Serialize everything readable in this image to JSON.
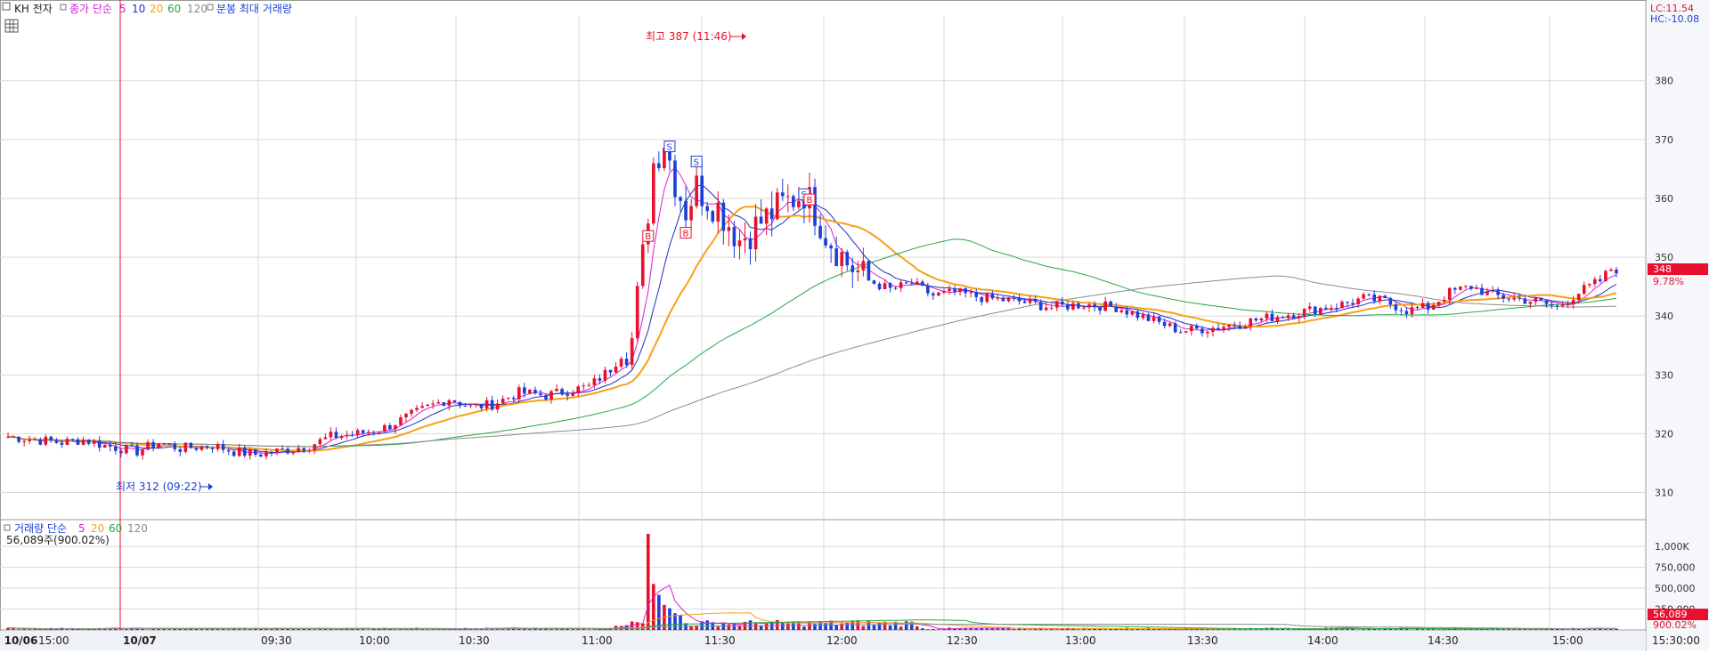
{
  "header": {
    "symbol": "KH 전자",
    "price_legend": {
      "label": "종가 단순",
      "periods": [
        "5",
        "10",
        "20",
        "60",
        "120"
      ]
    },
    "volume_legend_title": "분봉 최대 거래량"
  },
  "volume_panel": {
    "legend_label": "거래량 단순",
    "periods": [
      "5",
      "20",
      "60",
      "120"
    ],
    "info": "56,089주(900.02%)"
  },
  "right_info": {
    "lc": "LC:11.54",
    "hc": "HC:-10.08"
  },
  "colors": {
    "up": "#e8102c",
    "down": "#1b3fd8",
    "ma5": "#d81ed8",
    "ma10": "#1f2fbf",
    "ma20": "#f5a11a",
    "ma60": "#22a846",
    "ma120": "#8c8c8c",
    "grid": "#d9d9d9",
    "axis_text": "#333333"
  },
  "chart_data": {
    "type": "candlestick",
    "price_axis": {
      "ticks": [
        310,
        320,
        330,
        340,
        350,
        360,
        370,
        380
      ],
      "ylim": [
        306,
        391
      ]
    },
    "volume_axis": {
      "ticks": [
        "250,000",
        "500,000",
        "750,000",
        "1,000K"
      ],
      "ylim": [
        0,
        1150000
      ]
    },
    "time_axis": [
      "10/06",
      "15:00",
      "10/07",
      "09:30",
      "10:00",
      "10:30",
      "11:00",
      "11:30",
      "12:00",
      "12:30",
      "13:00",
      "13:30",
      "14:00",
      "14:30",
      "15:00",
      "15:30:00"
    ],
    "last_price": {
      "value": "348",
      "change": "9.78%"
    },
    "last_volume": {
      "value": "56,089",
      "ratio": "900.02%"
    },
    "annotations": {
      "high": {
        "text": "최고 387 (11:46)",
        "value": 387
      },
      "low": {
        "text": "최저 312 (09:22)",
        "value": 312
      }
    },
    "session_path": [
      [
        0,
        319.5
      ],
      [
        5,
        319.0
      ],
      [
        10,
        318.5
      ],
      [
        14,
        319.0
      ],
      [
        18,
        318.0
      ],
      [
        24,
        317.0
      ],
      [
        28,
        318.5
      ],
      [
        32,
        317.5
      ],
      [
        38,
        318.0
      ],
      [
        42,
        317.0
      ],
      [
        46,
        316.5
      ],
      [
        50,
        317.0
      ],
      [
        56,
        318.0
      ],
      [
        60,
        319.5
      ],
      [
        65,
        320.0
      ],
      [
        70,
        321.0
      ],
      [
        78,
        324.5
      ],
      [
        82,
        326.0
      ],
      [
        86,
        324.5
      ],
      [
        90,
        325.0
      ],
      [
        95,
        327.0
      ],
      [
        100,
        326.5
      ],
      [
        105,
        327.5
      ],
      [
        108,
        328.0
      ],
      [
        112,
        331.0
      ],
      [
        116,
        336.0
      ],
      [
        118,
        350.0
      ],
      [
        120,
        366.0
      ],
      [
        122,
        370.0
      ],
      [
        124,
        363.0
      ],
      [
        126,
        358.0
      ],
      [
        128,
        362.0
      ],
      [
        130,
        360.0
      ],
      [
        132,
        358.5
      ],
      [
        136,
        353.0
      ],
      [
        140,
        356.0
      ],
      [
        144,
        359.0
      ],
      [
        148,
        361.0
      ],
      [
        150,
        358.0
      ],
      [
        152,
        354.0
      ],
      [
        156,
        349.0
      ],
      [
        160,
        346.0
      ],
      [
        164,
        344.5
      ],
      [
        168,
        345.5
      ],
      [
        172,
        343.5
      ],
      [
        176,
        344.0
      ],
      [
        182,
        343.0
      ],
      [
        188,
        342.5
      ],
      [
        194,
        341.5
      ],
      [
        200,
        342.0
      ],
      [
        206,
        341.5
      ],
      [
        212,
        339.5
      ],
      [
        218,
        337.5
      ],
      [
        224,
        338.0
      ],
      [
        230,
        339.0
      ],
      [
        236,
        340.0
      ],
      [
        242,
        341.0
      ],
      [
        248,
        342.0
      ],
      [
        252,
        343.0
      ],
      [
        256,
        342.5
      ],
      [
        260,
        341.0
      ],
      [
        264,
        341.5
      ],
      [
        268,
        344.0
      ],
      [
        272,
        345.0
      ],
      [
        276,
        343.5
      ],
      [
        280,
        343.0
      ],
      [
        284,
        342.5
      ],
      [
        288,
        341.5
      ],
      [
        292,
        344.0
      ],
      [
        296,
        346.0
      ],
      [
        298,
        348.0
      ]
    ],
    "volume_spikes": [
      [
        119,
        1150000
      ],
      [
        120,
        550000
      ],
      [
        121,
        420000
      ],
      [
        122,
        300000
      ],
      [
        123,
        260000
      ],
      [
        124,
        200000
      ],
      [
        125,
        180000
      ]
    ]
  }
}
